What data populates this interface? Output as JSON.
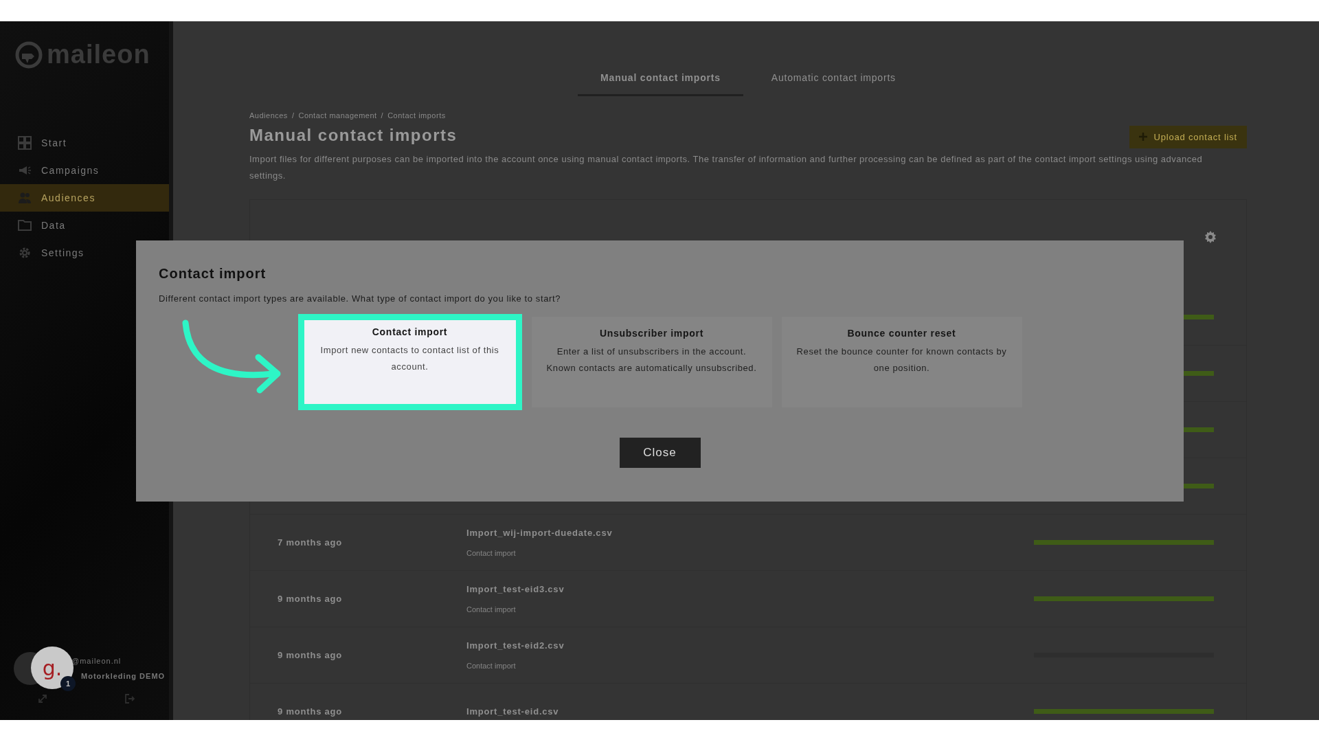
{
  "sidebar": {
    "logo": "maileon",
    "items": [
      {
        "label": "Start",
        "selected": false
      },
      {
        "label": "Campaigns",
        "selected": false
      },
      {
        "label": "Audiences",
        "selected": true
      },
      {
        "label": "Data",
        "selected": false
      },
      {
        "label": "Settings",
        "selected": false
      }
    ],
    "user": {
      "email": "@maileon.nl",
      "account": "Motorkleding DEMO"
    }
  },
  "tutorial_badge": {
    "logo": "g.",
    "count": "1"
  },
  "tabs": [
    {
      "label": "Manual contact imports",
      "selected": true
    },
    {
      "label": "Automatic contact imports",
      "selected": false
    }
  ],
  "breadcrumb": {
    "items": [
      "Audiences",
      "Contact management",
      "Contact imports"
    ],
    "separator": "/"
  },
  "page": {
    "title": "Manual contact imports",
    "description": "Import files for different purposes can be imported into the account once using manual contact imports. The transfer of information and further processing can be defined as part of the contact import settings using advanced settings.",
    "upload_button": "Upload contact list"
  },
  "imports": [
    {
      "level": 1
    },
    {
      "level": 1
    },
    {
      "level": 1
    },
    {
      "level": 1
    },
    {
      "age": "7 months ago",
      "file": "Import_wij-import-duedate.csv",
      "type": "Contact import",
      "level": 1
    },
    {
      "age": "9 months ago",
      "file": "Import_test-eid3.csv",
      "type": "Contact import",
      "level": 1
    },
    {
      "age": "9 months ago",
      "file": "Import_test-eid2.csv",
      "type": "Contact import",
      "level": 0
    },
    {
      "age": "9 months ago",
      "file": "Import_test-eid.csv",
      "level": 1
    }
  ],
  "modal": {
    "title": "Contact import",
    "subtitle": "Different contact import types are available. What type of contact import do you like to start?",
    "options": [
      {
        "title": "Contact import",
        "text": "Import new contacts to contact list of this account.",
        "highlighted": true
      },
      {
        "title": "Unsubscriber import",
        "text": "Enter a list of unsubscribers in the account. Known contacts are automatically unsubscribed.",
        "highlighted": false
      },
      {
        "title": "Bounce counter reset",
        "text": "Reset the bounce counter for known contacts by one position.",
        "highlighted": false
      }
    ],
    "close_button": "Close"
  }
}
